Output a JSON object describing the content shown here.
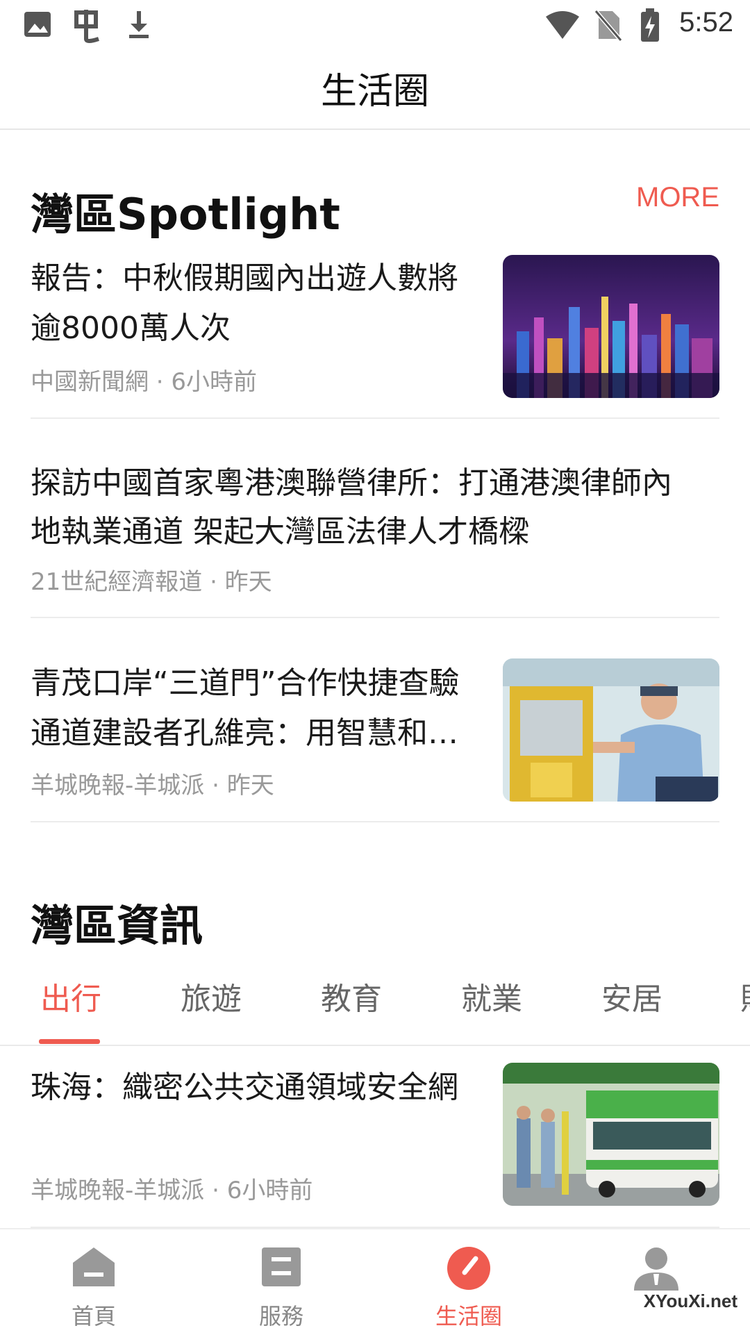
{
  "status_bar": {
    "time": "5:52"
  },
  "header": {
    "title": "生活圈"
  },
  "spotlight": {
    "title": "灣區Spotlight",
    "more_label": "MORE",
    "items": [
      {
        "title_line1": "報告：中秋假期國內出遊人數將",
        "title_line2": "逾8000萬人次",
        "meta": "中國新聞網 · 6小時前"
      },
      {
        "title_line1": "探訪中國首家粵港澳聯營律所：打通港澳律師內",
        "title_line2": "地執業通道 架起大灣區法律人才橋樑",
        "meta": "21世紀經濟報道 · 昨天"
      },
      {
        "title_line1": "青茂口岸“三道門”合作快捷查驗",
        "title_line2": "通道建設者孔維亮：用智慧和…",
        "meta": "羊城晚報-羊城派 · 昨天"
      }
    ]
  },
  "news": {
    "title": "灣區資訊",
    "tabs": [
      "出行",
      "旅遊",
      "教育",
      "就業",
      "安居",
      "財"
    ],
    "active_tab": 0,
    "items": [
      {
        "title": "珠海：織密公共交通領域安全網",
        "meta": "羊城晚報-羊城派 · 6小時前"
      }
    ]
  },
  "bottom_nav": {
    "items": [
      {
        "label": "首頁",
        "icon": "home-icon"
      },
      {
        "label": "服務",
        "icon": "services-icon"
      },
      {
        "label": "生活圈",
        "icon": "compass-icon"
      },
      {
        "label": "",
        "icon": "person-icon"
      }
    ],
    "active": 2
  },
  "watermark": "XYouXi.net",
  "colors": {
    "accent": "#ef5b50",
    "text": "#1a1a1a",
    "meta": "#999999",
    "nav_inactive": "#888888"
  }
}
